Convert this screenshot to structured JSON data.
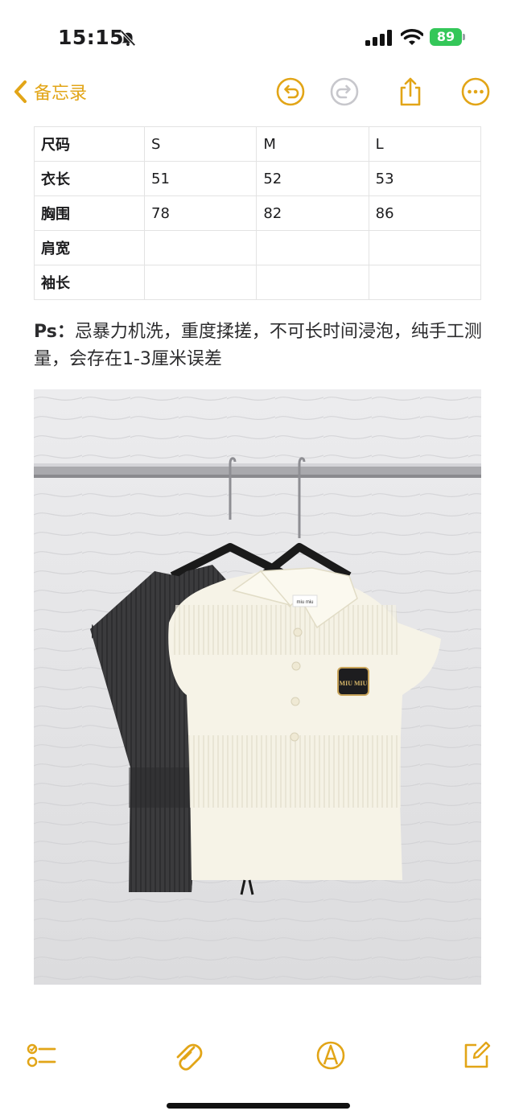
{
  "status_bar": {
    "time": "15:15",
    "battery": "89"
  },
  "nav": {
    "back_label": "备忘录"
  },
  "size_table": {
    "rows": [
      [
        "尺码",
        "S",
        "M",
        "L"
      ],
      [
        "衣长",
        "51",
        "52",
        "53"
      ],
      [
        "胸围",
        "78",
        "82",
        "86"
      ],
      [
        "肩宽",
        "",
        "",
        ""
      ],
      [
        "袖长",
        "",
        "",
        ""
      ]
    ]
  },
  "note": {
    "prefix": "Ps：",
    "text": "忌暴力机洗，重度揉搓，不可长时间浸泡，纯手工测量，会存在1-3厘米误差"
  },
  "photo": {
    "label_text": "miu miu",
    "patch_text": "MIU MIU"
  },
  "colors": {
    "accent": "#e2a517",
    "battery": "#34c759"
  }
}
